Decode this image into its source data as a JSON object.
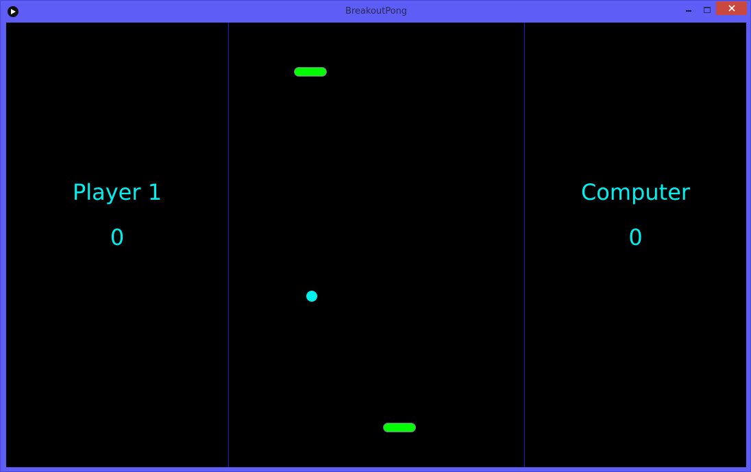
{
  "window": {
    "title": "BreakoutPong",
    "close_glyph": "✕"
  },
  "players": {
    "left": {
      "name": "Player 1",
      "score": "0"
    },
    "right": {
      "name": "Computer",
      "score": "0"
    }
  },
  "colors": {
    "text": "#00f0f0",
    "paddle": "#00ff00",
    "ball": "#00f0f0",
    "divider": "#1a1acc",
    "frame": "#5e5ef7",
    "close_button": "#c9483f"
  },
  "icons": {
    "app": "play-icon",
    "minimize": "minimize-icon",
    "maximize": "maximize-icon",
    "close": "close-icon"
  }
}
